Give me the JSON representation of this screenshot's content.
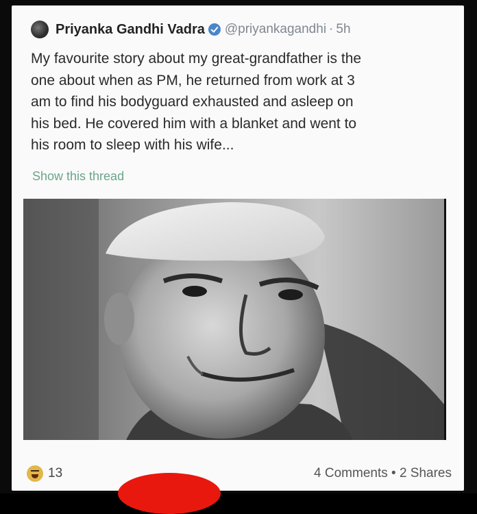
{
  "post": {
    "author": "Priyanka Gandhi Vadra",
    "handle": "@priyankagandhi",
    "separator": "·",
    "time": "5h",
    "text_lines": [
      "My favourite story about my great-grandfather is the",
      "one about when as PM, he returned from work at 3",
      "am to find his bodyguard exhausted and asleep on",
      "his bed. He covered him with a blanket and went to",
      "his room to sleep with his wife..."
    ],
    "show_thread": "Show this thread",
    "icons": {
      "avatar": "avatar-icon",
      "verified": "verified-badge-icon"
    }
  },
  "photo": {
    "description_icon": "portrait-photo"
  },
  "footer": {
    "reaction_icon": "laugh-reaction-icon",
    "reaction_count": "13",
    "comments": "4 Comments",
    "shares_separator": "•",
    "shares": "2 Shares"
  },
  "colors": {
    "verified": "#4a86c9",
    "show_thread": "#6ba58a",
    "handle": "#7f8790",
    "reaction": "#e3b64a",
    "red_shape": "#e8180f"
  }
}
